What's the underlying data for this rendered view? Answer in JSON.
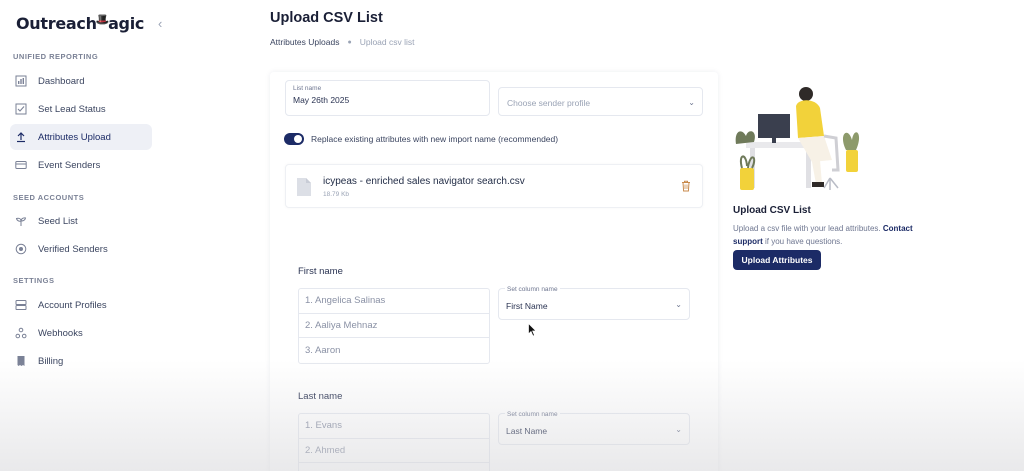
{
  "brand": {
    "logo_text_left": "Outreach",
    "logo_text_right": "agic"
  },
  "sidebar": {
    "sections": [
      {
        "title": "UNIFIED REPORTING",
        "items": [
          {
            "label": "Dashboard",
            "icon": "bar-chart-icon"
          },
          {
            "label": "Set Lead Status",
            "icon": "checkbox-icon"
          },
          {
            "label": "Attributes Upload",
            "icon": "upload-icon",
            "active": true
          },
          {
            "label": "Event Senders",
            "icon": "credit-card-icon"
          }
        ]
      },
      {
        "title": "SEED ACCOUNTS",
        "items": [
          {
            "label": "Seed List",
            "icon": "sprout-icon"
          },
          {
            "label": "Verified Senders",
            "icon": "verified-icon"
          }
        ]
      },
      {
        "title": "SETTINGS",
        "items": [
          {
            "label": "Account Profiles",
            "icon": "server-icon"
          },
          {
            "label": "Webhooks",
            "icon": "webhook-icon"
          },
          {
            "label": "Billing",
            "icon": "receipt-icon"
          }
        ]
      }
    ]
  },
  "header": {
    "title": "Upload CSV List",
    "breadcrumb": {
      "parent": "Attributes Uploads",
      "current": "Upload csv list"
    }
  },
  "form": {
    "list_name_label": "List name",
    "list_name_value": "May 26th 2025",
    "sender_placeholder": "Choose sender profile",
    "toggle_label": "Replace existing attributes with new import name (recommended)",
    "toggle_on": true,
    "file": {
      "name": "icypeas - enriched sales navigator search.csv",
      "size": "18.79 Kb"
    }
  },
  "columns": [
    {
      "title": "First name",
      "samples": [
        "1. Angelica Salinas",
        "2. Aaliya Mehnaz",
        "3. Aaron"
      ],
      "set_label": "Set column name",
      "set_value": "First Name"
    },
    {
      "title": "Last name",
      "samples": [
        "1. Evans",
        "2. Ahmed",
        ""
      ],
      "set_label": "Set column name",
      "set_value": "Last Name"
    }
  ],
  "panel": {
    "title": "Upload CSV List",
    "text_before": "Upload a csv file with your lead attributes. ",
    "link_text": "Contact support",
    "text_after": " if you have questions.",
    "button_label": "Upload Attributes"
  },
  "colors": {
    "primary": "#1c2b66",
    "muted": "#9aa3b5",
    "border": "#e5e8ef"
  }
}
